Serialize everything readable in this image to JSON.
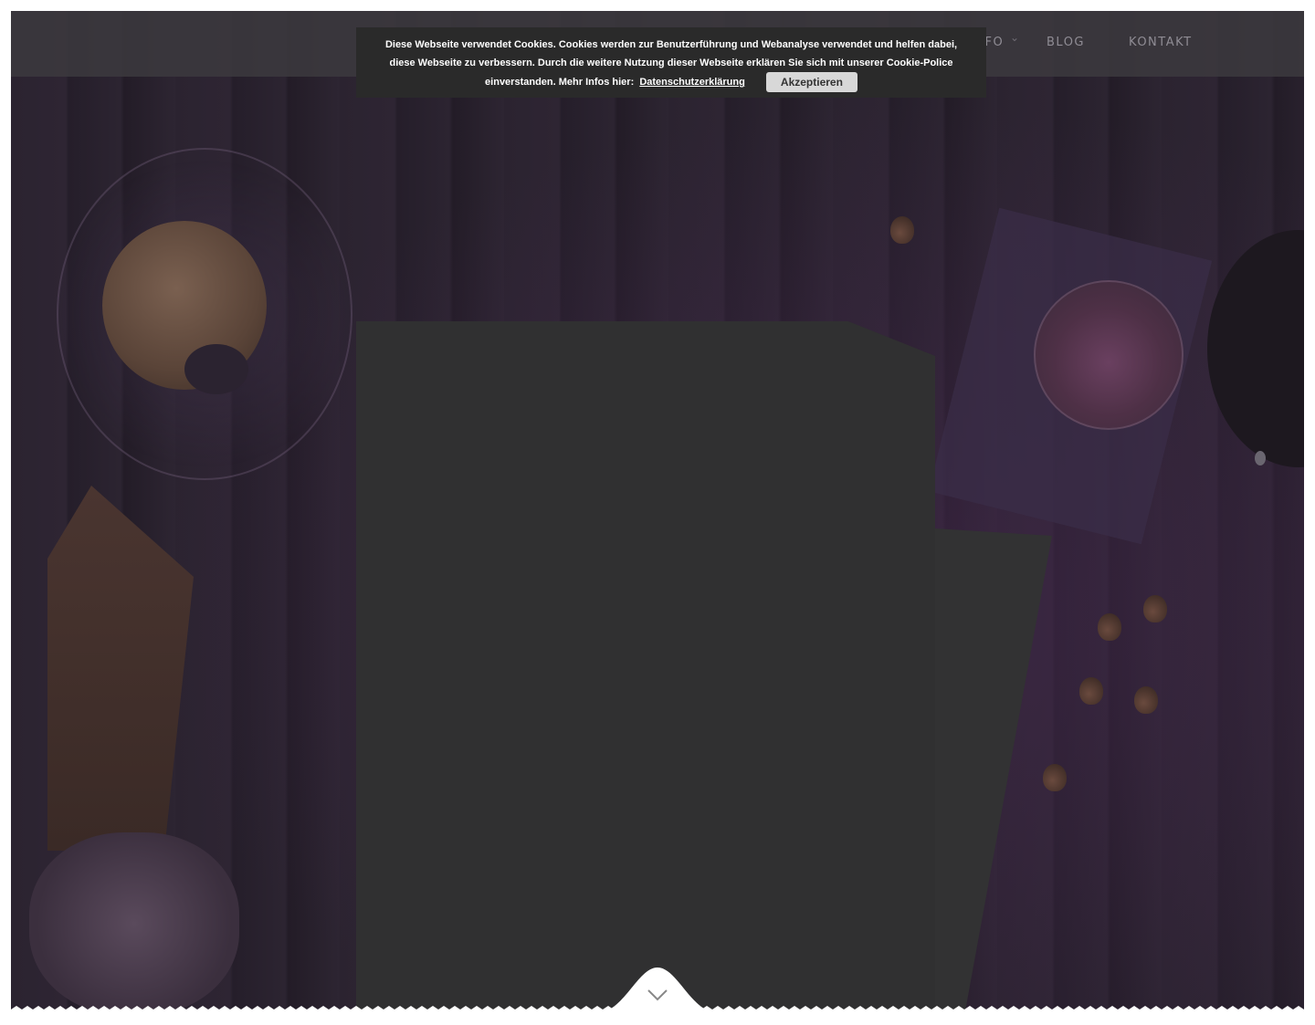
{
  "nav": {
    "items": [
      {
        "label": "INFO"
      },
      {
        "label": "BLOG"
      },
      {
        "label": "KONTAKT"
      }
    ]
  },
  "cookie_banner": {
    "text": "Diese Webseite verwendet Cookies. Cookies werden zur Benutzerführung und Webanalyse verwendet und helfen dabei, diese Webseite zu verbessern. Durch die weitere Nutzung dieser Webseite erklären Sie sich mit unserer Cookie-Police einverstanden. Mehr Infos hier:",
    "link_label": "Datenschutzerklärung",
    "accept_label": "Akzeptieren"
  },
  "icons": {
    "nav_dropdown": "chevron-down-icon",
    "scroll_down": "chevron-down-icon"
  },
  "colors": {
    "header_bg": "#3c3a3e",
    "cookie_bg": "#2a2a2a",
    "nav_text": "#8f8c94",
    "accept_button_bg": "#d8d8d8"
  }
}
